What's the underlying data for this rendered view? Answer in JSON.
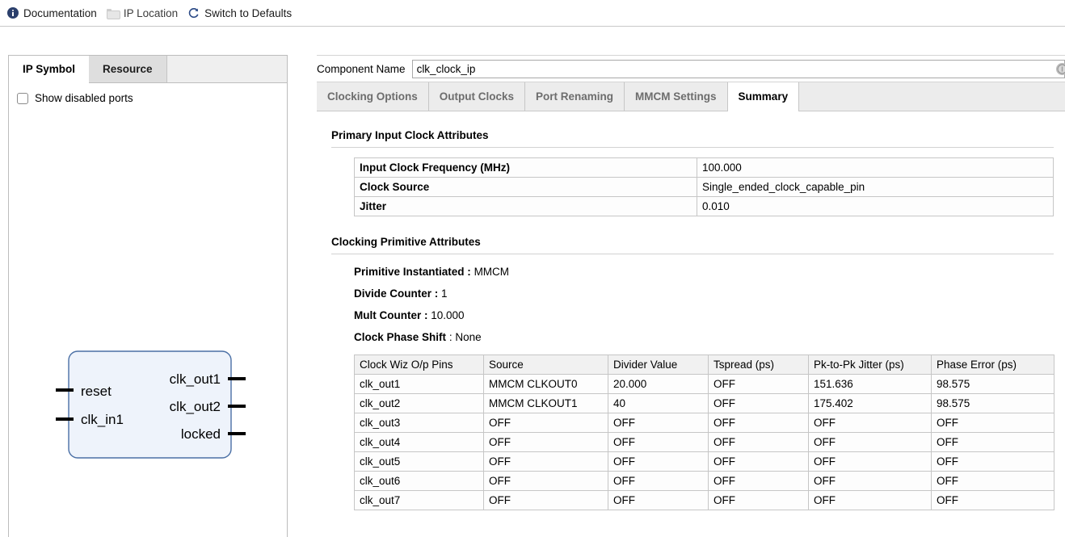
{
  "toolbar": {
    "items": [
      {
        "label": "Documentation",
        "icon": "info-icon",
        "disabled": false
      },
      {
        "label": "IP Location",
        "icon": "folder-icon",
        "disabled": true
      },
      {
        "label": "Switch to Defaults",
        "icon": "refresh-icon",
        "disabled": false
      }
    ]
  },
  "left_panel": {
    "tabs": [
      {
        "label": "IP Symbol",
        "active": true
      },
      {
        "label": "Resource",
        "active": false
      }
    ],
    "show_disabled_ports": {
      "label": "Show disabled ports",
      "checked": false
    },
    "symbol": {
      "inputs": [
        "reset",
        "clk_in1"
      ],
      "outputs": [
        "clk_out1",
        "clk_out2",
        "locked"
      ],
      "fill_color": "#eef3fb",
      "border_color": "#4a6fa5"
    }
  },
  "component_name": {
    "label": "Component Name",
    "value": "clk_clock_ip",
    "placeholder": "Component Name"
  },
  "main_tabs": [
    {
      "label": "Clocking Options",
      "active": false
    },
    {
      "label": "Output Clocks",
      "active": false
    },
    {
      "label": "Port Renaming",
      "active": false
    },
    {
      "label": "MMCM Settings",
      "active": false
    },
    {
      "label": "Summary",
      "active": true
    }
  ],
  "primary_input_clock": {
    "title": "Primary Input Clock Attributes",
    "rows": [
      {
        "key": "Input Clock Frequency (MHz)",
        "value": "100.000"
      },
      {
        "key": "Clock Source",
        "value": "Single_ended_clock_capable_pin"
      },
      {
        "key": "Jitter",
        "value": "0.010"
      }
    ]
  },
  "clocking_primitive": {
    "title": "Clocking Primitive Attributes",
    "attributes": [
      {
        "key": "Primitive Instantiated :",
        "value": "MMCM"
      },
      {
        "key": "Divide Counter :",
        "value": "1"
      },
      {
        "key": "Mult Counter :",
        "value": "10.000"
      },
      {
        "key": "Clock Phase Shift",
        "value": ": None"
      }
    ],
    "table": {
      "columns": [
        "Clock Wiz O/p Pins",
        "Source",
        "Divider Value",
        "Tspread (ps)",
        "Pk-to-Pk Jitter (ps)",
        "Phase Error (ps)"
      ],
      "rows": [
        [
          "clk_out1",
          "MMCM CLKOUT0",
          "20.000",
          "OFF",
          "151.636",
          "98.575"
        ],
        [
          "clk_out2",
          "MMCM CLKOUT1",
          "40",
          "OFF",
          "175.402",
          "98.575"
        ],
        [
          "clk_out3",
          "OFF",
          "OFF",
          "OFF",
          "OFF",
          "OFF"
        ],
        [
          "clk_out4",
          "OFF",
          "OFF",
          "OFF",
          "OFF",
          "OFF"
        ],
        [
          "clk_out5",
          "OFF",
          "OFF",
          "OFF",
          "OFF",
          "OFF"
        ],
        [
          "clk_out6",
          "OFF",
          "OFF",
          "OFF",
          "OFF",
          "OFF"
        ],
        [
          "clk_out7",
          "OFF",
          "OFF",
          "OFF",
          "OFF",
          "OFF"
        ]
      ]
    }
  }
}
